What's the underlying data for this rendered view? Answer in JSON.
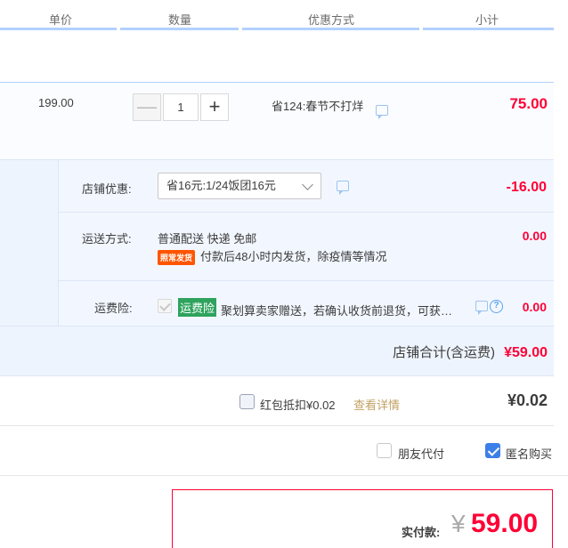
{
  "header": {
    "col_price": "单价",
    "col_qty": "数量",
    "col_promo": "优惠方式",
    "col_subtotal": "小计"
  },
  "item": {
    "price": "199.00",
    "quantity": "1",
    "minus": "—",
    "plus": "+",
    "promo": "省124:春节不打烊",
    "subtotal": "75.00"
  },
  "store": {
    "discount_label": "店铺优惠:",
    "discount_selected": "省16元:1/24饭团16元",
    "discount_amount": "-16.00",
    "shipping_label": "运送方式:",
    "shipping_method": "普通配送 快递 免邮",
    "shipping_badge": "照常发货",
    "shipping_note": "付款后48小时内发货，除疫情等情况",
    "shipping_amount": "0.00",
    "insurance_label": "运费险:",
    "insurance_badge": "运费险",
    "insurance_text": "聚划算卖家赠送，若确认收货前退货，可获…",
    "insurance_amount": "0.00",
    "total_label": "店铺合计(含运费)",
    "total_amount": "¥59.00"
  },
  "redpacket": {
    "label": "红包抵扣¥0.02",
    "link": "查看详情",
    "amount": "¥0.02"
  },
  "options": {
    "friend_pay": "朋友代付",
    "anonymous": "匿名购买"
  },
  "pay": {
    "label": "实付款:",
    "currency": "¥",
    "amount": "59.00"
  },
  "colors": {
    "accent_red": "#ff0036",
    "header_line": "#b2d1ff",
    "store_bg": "#eef4fe",
    "badge_green": "#2ea35d",
    "badge_orange": "#ff5500",
    "checkbox_blue": "#3d7fe8"
  }
}
